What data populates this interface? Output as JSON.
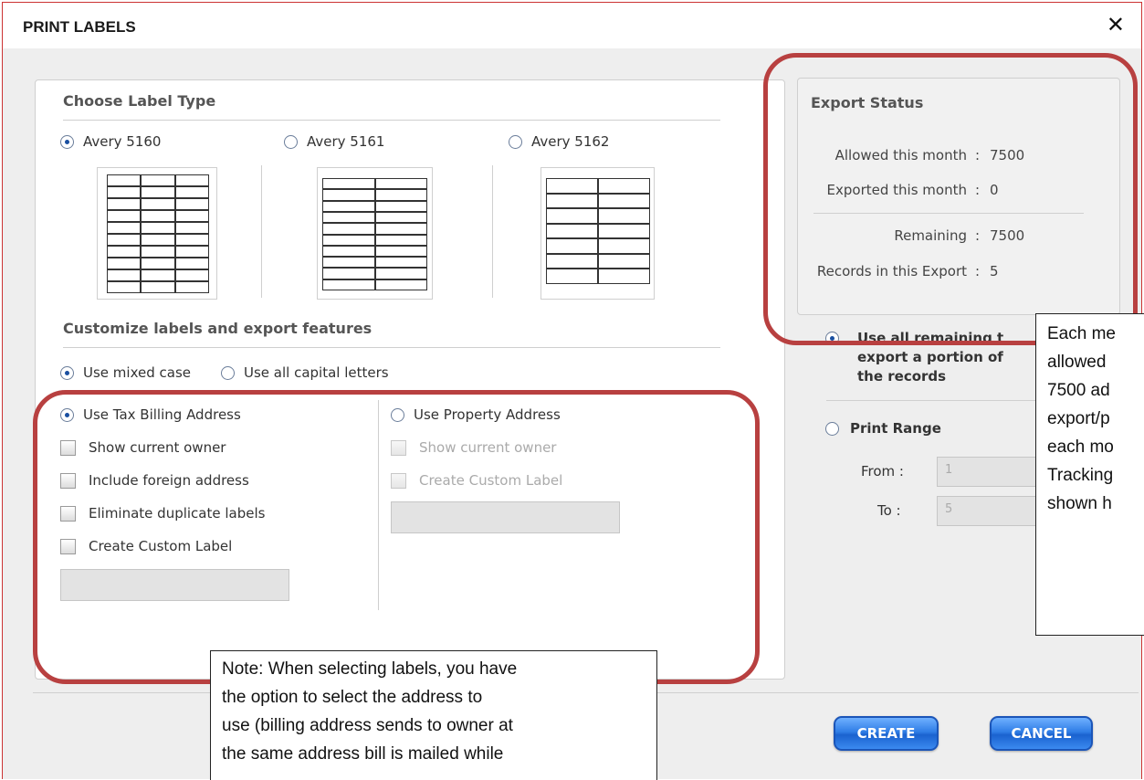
{
  "dialog": {
    "title": "PRINT LABELS",
    "close_icon": "close-icon"
  },
  "label_type": {
    "heading": "Choose Label Type",
    "options": [
      {
        "label": "Avery 5160",
        "selected": true,
        "columns": 3,
        "rows": 10
      },
      {
        "label": "Avery 5161",
        "selected": false,
        "columns": 2,
        "rows": 10
      },
      {
        "label": "Avery 5162",
        "selected": false,
        "columns": 2,
        "rows": 7
      }
    ]
  },
  "customize": {
    "heading": "Customize labels and export features",
    "case_options": [
      {
        "label": "Use mixed case",
        "selected": true
      },
      {
        "label": "Use all capital letters",
        "selected": false
      }
    ],
    "tax_billing": {
      "label": "Use Tax Billing Address",
      "selected": true,
      "checkboxes": [
        "Show current owner",
        "Include foreign address",
        "Eliminate duplicate labels",
        "Create Custom Label"
      ],
      "custom_label_value": ""
    },
    "property": {
      "label": "Use Property Address",
      "selected": false,
      "checkboxes": [
        "Show current owner",
        "Create Custom Label"
      ],
      "custom_label_value": ""
    }
  },
  "export_status": {
    "heading": "Export Status",
    "rows": [
      {
        "label": "Allowed this month",
        "value": "7500"
      },
      {
        "label": "Exported this month",
        "value": "0"
      },
      {
        "label": "Remaining",
        "value": "7500"
      },
      {
        "label": "Records in this Export",
        "value": "5"
      }
    ],
    "colon": ":"
  },
  "export_scope": {
    "use_all": {
      "lines": [
        "Use all remaining t",
        "export a portion of",
        "the records"
      ],
      "selected": true
    },
    "print_range": {
      "label": "Print Range",
      "selected": false,
      "from_label": "From :",
      "from_value": "1",
      "to_label": "To :",
      "to_value": "5"
    }
  },
  "callouts": {
    "right": [
      "Each me",
      "allowed",
      "7500 ad",
      "export/p",
      "each mo",
      "Tracking",
      "shown h"
    ],
    "bottom": [
      "Note: When selecting labels, you have",
      "the option to select the address to",
      "use (billing address sends to owner at",
      "the same address bill is mailed while"
    ]
  },
  "buttons": {
    "create": "CREATE",
    "cancel": "CANCEL"
  },
  "colors": {
    "highlight": "#b84040",
    "button": "#2f7de6",
    "dialog_border": "#cc3333"
  }
}
